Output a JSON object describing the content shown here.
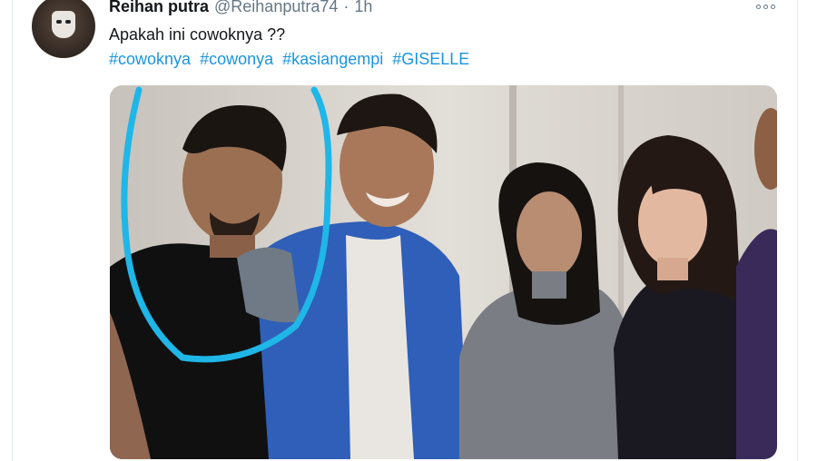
{
  "tweet": {
    "display_name": "Reihan putra",
    "handle": "@Reihanputra74",
    "separator": "·",
    "time": "1h",
    "text": "Apakah ini cowoknya ??",
    "hashtags": [
      "#cowoknya",
      "#cowonya",
      "#kasiangempi",
      "#GISELLE"
    ],
    "media": {
      "description_icon": "photo",
      "highlight_color": "#1fb6e8"
    }
  },
  "icons": {
    "avatar": "user-avatar",
    "more": "more-options-icon"
  },
  "colors": {
    "link": "#1b95e0",
    "secondary_text": "#657786",
    "primary_text": "#14171a"
  }
}
